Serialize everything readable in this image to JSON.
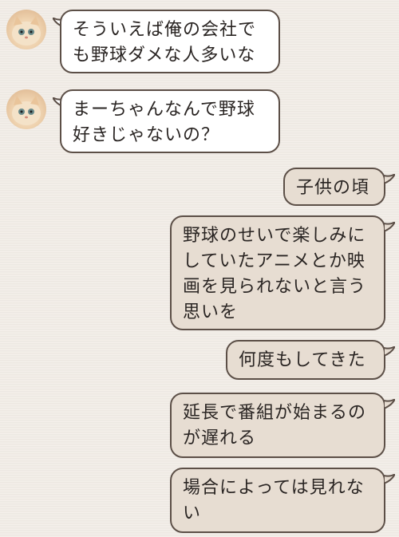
{
  "messages": [
    {
      "side": "in",
      "text": "そういえば俺の会社で\nも野球ダメな人多いな"
    },
    {
      "side": "in",
      "text": "まーちゃんなんで野球\n好きじゃないの？"
    },
    {
      "side": "out",
      "text": "子供の頃"
    },
    {
      "side": "out",
      "text": "野球のせいで楽しみに\nしていたアニメとか映\n画を見られないと言う\n思いを"
    },
    {
      "side": "out",
      "text": "何度もしてきた"
    },
    {
      "side": "out",
      "text": "延長で番組が始まるの\nが遅れる"
    },
    {
      "side": "out",
      "text": "場合によっては見れな\nい"
    }
  ],
  "colors": {
    "background": "#f1ece6",
    "incoming_bubble": "#ffffff",
    "outgoing_bubble": "#e7ddd2",
    "border": "#5c4f47"
  },
  "icons": {
    "avatar": "cat-avatar-icon"
  }
}
